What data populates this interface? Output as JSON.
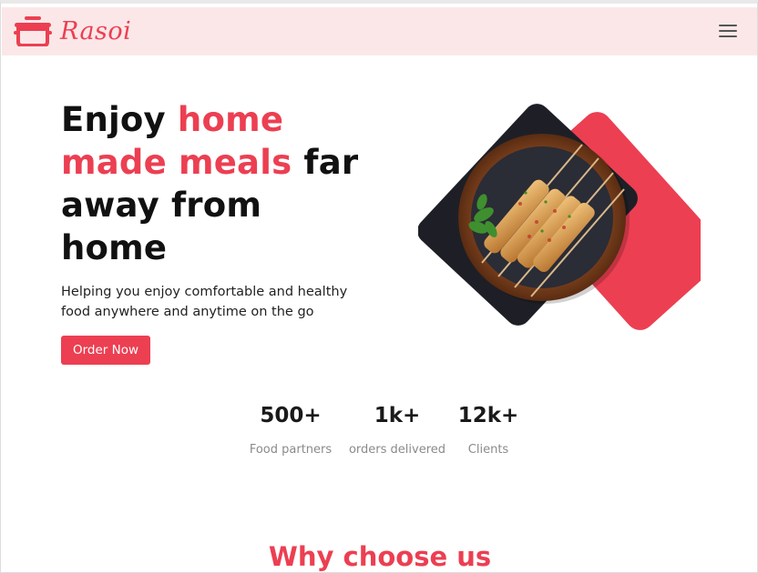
{
  "brand": {
    "name": "Rasoi",
    "logo_icon": "cooking-pot-icon"
  },
  "nav": {
    "menu_icon": "hamburger-menu-icon"
  },
  "hero": {
    "title_part1": "Enjoy ",
    "title_accent": "home made meals",
    "title_part2": " far away from home",
    "subtitle": "Helping you enjoy comfortable and healthy food anywhere and anytime on the go",
    "cta_label": "Order Now",
    "image_subject": "chicken skewers on a plate"
  },
  "stats": [
    {
      "value": "500+",
      "label": "Food partners"
    },
    {
      "value": "1k+",
      "label": "orders delivered"
    },
    {
      "value": "12k+",
      "label": "Clients"
    }
  ],
  "next_section": {
    "title": "Why choose us"
  },
  "colors": {
    "accent": "#ec3f52",
    "nav_bg": "#fbe7e8",
    "dark_tile": "#1e1f26",
    "text": "#111111",
    "muted": "#8a8a8a"
  }
}
